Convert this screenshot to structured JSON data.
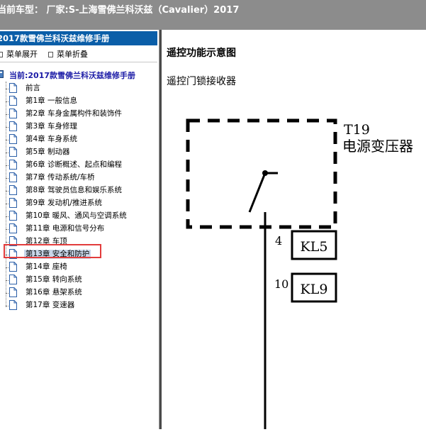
{
  "window": {
    "title": "当前车型：  厂家:S-上海雪佛兰科沃兹（Cavalier）2017"
  },
  "sidebar": {
    "manual_title": "2017款雪佛兰科沃兹维修手册",
    "expand_label": "菜单展开",
    "collapse_label": "菜单折叠",
    "current_label": "当前:2017款雪佛兰科沃兹维修手册",
    "items": [
      {
        "label": "前言"
      },
      {
        "label": "第1章  一般信息"
      },
      {
        "label": "第2章  车身金属构件和装饰件"
      },
      {
        "label": "第3章  车身修理"
      },
      {
        "label": "第4章  车身系统"
      },
      {
        "label": "第5章  制动器"
      },
      {
        "label": "第6章  诊断概述、起点和编程"
      },
      {
        "label": "第7章  传动系统/车桥"
      },
      {
        "label": "第8章  驾驶员信息和娱乐系统"
      },
      {
        "label": "第9章  发动机/推进系统"
      },
      {
        "label": "第10章  暖风、通风与空调系统"
      },
      {
        "label": "第11章  电源和信号分布"
      },
      {
        "label": "第12章  车顶"
      },
      {
        "label": "第13章  安全和防护",
        "selected": true
      },
      {
        "label": "第14章  座椅"
      },
      {
        "label": "第15章  转向系统"
      },
      {
        "label": "第16章  悬架系统"
      },
      {
        "label": "第17章  变速器"
      }
    ]
  },
  "content": {
    "heading": "遥控功能示意图",
    "subheading": "遥控门锁接收器",
    "diagram": {
      "component_ref": "T19",
      "component_name": "电源变压器",
      "pins": [
        {
          "pin": "4",
          "connector": "KL5"
        },
        {
          "pin": "10",
          "connector": "KL9"
        }
      ]
    }
  },
  "colors": {
    "titlebar": "#8c8c8c",
    "manual_header": "#0a5ea8",
    "current_text": "#1a1aa6",
    "selection": "#c9d7ea",
    "highlight": "#e23c3c"
  }
}
